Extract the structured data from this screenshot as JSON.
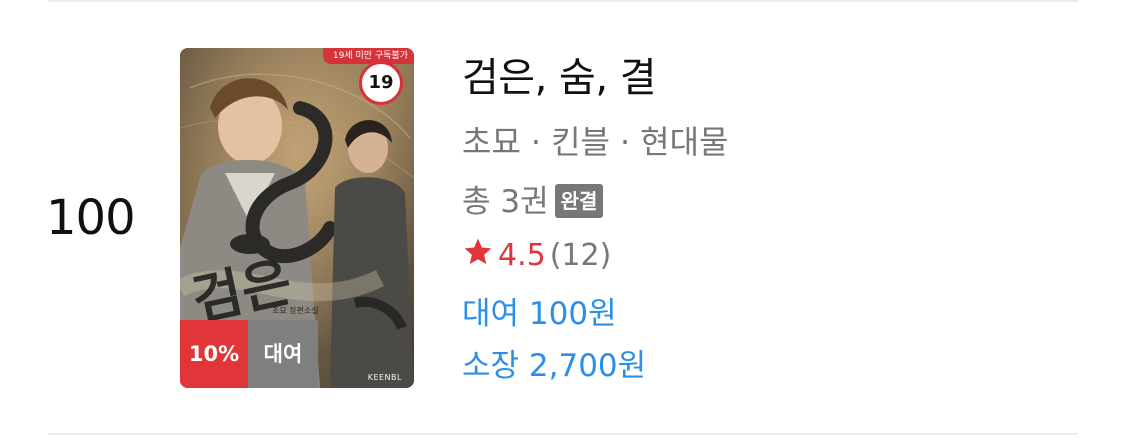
{
  "rank": "100",
  "book": {
    "cover": {
      "age_ribbon": "19세 미만 구독불가",
      "age_badge": "19",
      "cover_title": "검은",
      "cover_small_text": "초묘 장편소설",
      "publisher": "KEENBL",
      "discount_badge": "10%",
      "rent_badge": "대여"
    },
    "title": "검은, 숨, 결",
    "author": "초묘",
    "category": "킨블",
    "genre": "현대물",
    "separator": "·",
    "volumes": "총 3권",
    "complete_badge": "완결",
    "rating": "4.5",
    "rating_count": "(12)",
    "rent_price": "대여 100원",
    "own_price": "소장 2,700원"
  },
  "colors": {
    "accent_red": "#e0363a",
    "price_blue": "#2b8ee8",
    "meta_gray": "#777777"
  },
  "icons": {
    "star": "star-icon"
  }
}
